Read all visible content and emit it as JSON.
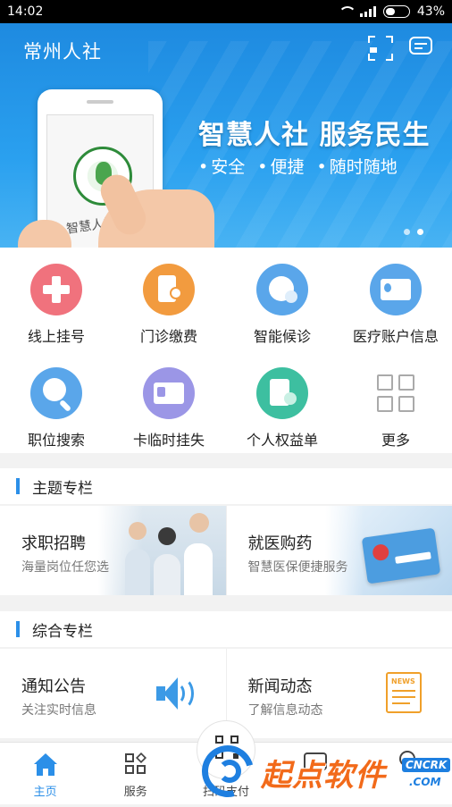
{
  "status_bar": {
    "time": "14:02",
    "battery": "43%",
    "battery_level": 0.43
  },
  "header": {
    "title": "常州人社",
    "scan_icon": "scan-icon",
    "message_icon": "message-icon"
  },
  "banner": {
    "slogan": "智慧人社  服务民生",
    "tags": [
      "安全",
      "便捷",
      "随时随地"
    ],
    "phone_text": "智慧人社",
    "slide_count": 2,
    "active_slide": 2
  },
  "functions": [
    {
      "label": "线上挂号",
      "icon": "hospital-cross-icon",
      "color": "#f0727d"
    },
    {
      "label": "门诊缴费",
      "icon": "payment-receipt-icon",
      "color": "#f29b3f"
    },
    {
      "label": "智能候诊",
      "icon": "clock-person-icon",
      "color": "#5aa6ea"
    },
    {
      "label": "医疗账户信息",
      "icon": "account-card-icon",
      "color": "#5aa6ea"
    },
    {
      "label": "职位搜索",
      "icon": "person-search-icon",
      "color": "#5aa6ea"
    },
    {
      "label": "卡临时挂失",
      "icon": "card-report-loss-icon",
      "color": "#9b96e6"
    },
    {
      "label": "个人权益单",
      "icon": "document-person-icon",
      "color": "#3dbfa0"
    },
    {
      "label": "更多",
      "icon": "more-grid-icon",
      "color": "#cccccc"
    }
  ],
  "section_theme": {
    "title": "主题专栏",
    "cards": [
      {
        "title": "求职招聘",
        "subtitle": "海量岗位任您选"
      },
      {
        "title": "就医购药",
        "subtitle": "智慧医保便捷服务"
      }
    ]
  },
  "section_general": {
    "title": "综合专栏",
    "cards": [
      {
        "title": "通知公告",
        "subtitle": "关注实时信息",
        "icon": "speaker-icon"
      },
      {
        "title": "新闻动态",
        "subtitle": "了解信息动态",
        "icon": "news-icon",
        "icon_text": "NEWS"
      }
    ]
  },
  "bottom_nav": [
    {
      "label": "主页",
      "icon": "home-icon",
      "active": true
    },
    {
      "label": "服务",
      "icon": "services-icon",
      "active": false
    },
    {
      "label": "扫码支付",
      "icon": "qr-scan-icon",
      "active": false
    },
    {
      "label": "",
      "icon": "message-icon",
      "active": false
    },
    {
      "label": "",
      "icon": "profile-icon",
      "active": false
    }
  ],
  "watermark": {
    "brand": "起点软件",
    "domain": "CNCRK",
    "suffix": ".COM"
  },
  "colors": {
    "primary": "#2b8fe8",
    "watermark_orange": "#f26a1a"
  }
}
